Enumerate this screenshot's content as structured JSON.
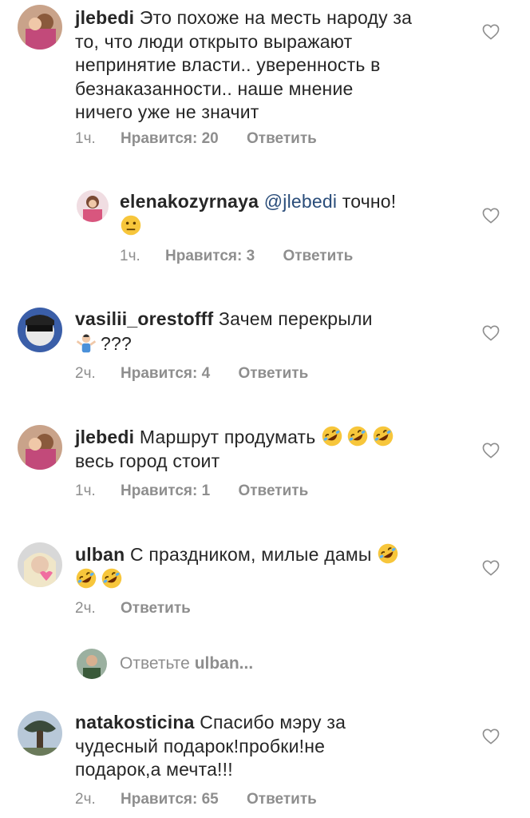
{
  "comments": [
    {
      "username": "jlebedi",
      "lines": [
        "Это похоже на месть народу за",
        "то, что люди открыто выражают",
        "непринятие власти.. уверенность в",
        "безнаказанности.. наше мнение",
        "ничего уже не значит"
      ],
      "time": "1ч.",
      "likes": "Нравится: 20",
      "reply": "Ответить",
      "avatar_icon": "profile-photo"
    },
    {
      "username": "elenakozyrnaya",
      "mention": "@jlebedi",
      "text": "точно!",
      "emoji": "neutral-face",
      "time": "1ч.",
      "likes": "Нравится: 3",
      "reply": "Ответить",
      "avatar_icon": "profile-photo"
    },
    {
      "username": "vasilii_orestofff",
      "text": "Зачем перекрыли",
      "line2": "???",
      "emoji": "person-shrugging",
      "time": "2ч.",
      "likes": "Нравится: 4",
      "reply": "Ответить",
      "avatar_icon": "profile-photo"
    },
    {
      "username": "jlebedi",
      "text": "Маршрут продумать",
      "line2": "весь город стоит",
      "emoji": "rolling-on-floor-laughing",
      "time": "1ч.",
      "likes": "Нравится: 1",
      "reply": "Ответить",
      "avatar_icon": "profile-photo"
    },
    {
      "username": "ulban",
      "text": "С праздником, милые дамы",
      "emoji": "rolling-on-floor-laughing",
      "time": "2ч.",
      "reply": "Ответить",
      "avatar_icon": "profile-photo"
    },
    {
      "username": "natakosticina",
      "lines": [
        "Спасибо мэру за",
        "чудесный подарок!пробки!не",
        "подарок,а мечта!!!"
      ],
      "time": "2ч.",
      "likes": "Нравится: 65",
      "reply": "Ответить",
      "avatar_icon": "profile-photo"
    }
  ],
  "reply_prompt": {
    "prefix": "Ответьте",
    "username": "ulban...",
    "avatar_icon": "profile-photo"
  },
  "icons": {
    "like": "heart-outline-icon"
  },
  "colors": {
    "text": "#262626",
    "meta": "#8e8e8e",
    "mention": "#2a4d7a"
  }
}
